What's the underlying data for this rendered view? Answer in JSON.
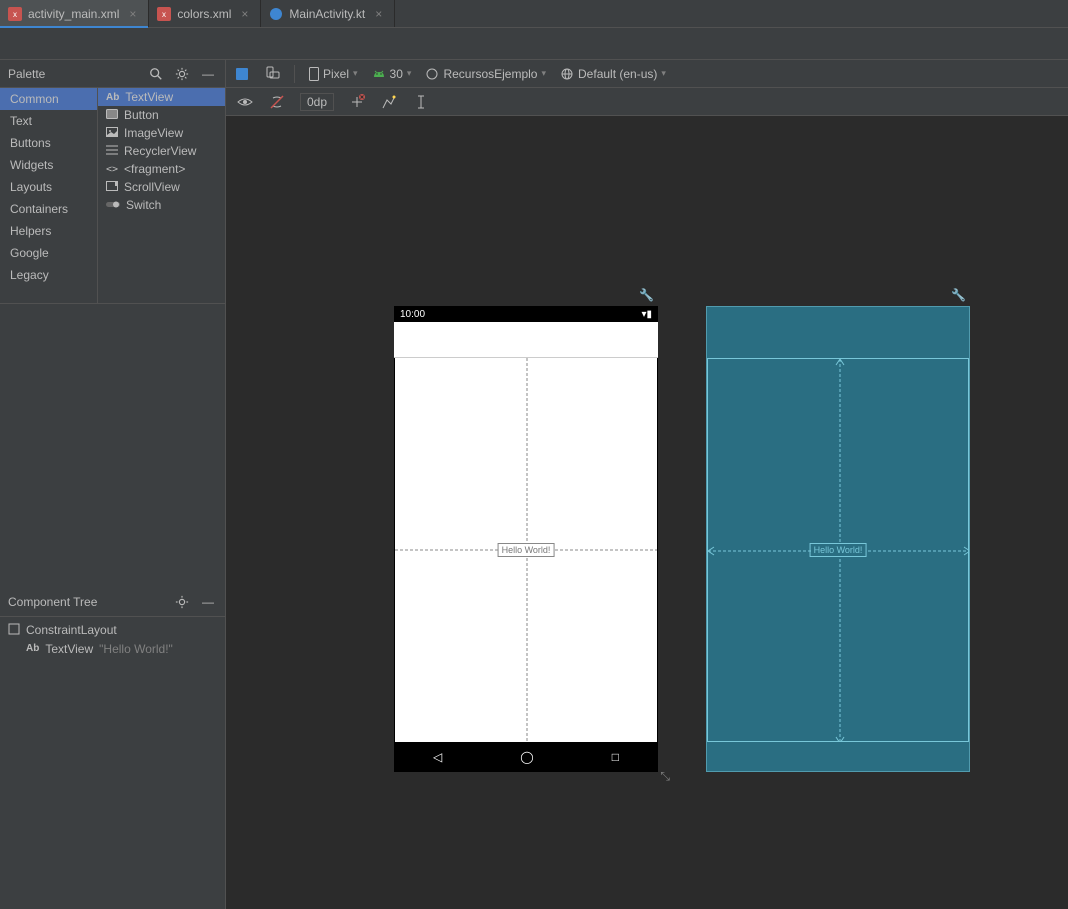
{
  "tabs": [
    {
      "label": "activity_main.xml",
      "icon": "xml",
      "active": true
    },
    {
      "label": "colors.xml",
      "icon": "xml",
      "active": false
    },
    {
      "label": "MainActivity.kt",
      "icon": "kotlin",
      "active": false
    }
  ],
  "palette": {
    "title": "Palette",
    "categories": [
      "Common",
      "Text",
      "Buttons",
      "Widgets",
      "Layouts",
      "Containers",
      "Helpers",
      "Google",
      "Legacy"
    ],
    "selected_category": "Common",
    "items": [
      {
        "label": "TextView",
        "icon": "Ab"
      },
      {
        "label": "Button",
        "icon": "button"
      },
      {
        "label": "ImageView",
        "icon": "image"
      },
      {
        "label": "RecyclerView",
        "icon": "list"
      },
      {
        "label": "<fragment>",
        "icon": "frag"
      },
      {
        "label": "ScrollView",
        "icon": "scroll"
      },
      {
        "label": "Switch",
        "icon": "switch"
      }
    ],
    "selected_item": "TextView"
  },
  "component_tree": {
    "title": "Component Tree",
    "nodes": [
      {
        "label": "ConstraintLayout",
        "icon": "layout"
      },
      {
        "label": "TextView",
        "value": "\"Hello World!\"",
        "icon": "Ab",
        "indent": 1
      }
    ]
  },
  "design_toolbar": {
    "device": "Pixel",
    "api": "30",
    "app_theme": "RecursosEjemplo",
    "locale": "Default (en-us)"
  },
  "sub_toolbar": {
    "margin": "0dp"
  },
  "device_preview": {
    "status_time": "10:00",
    "textview_text": "Hello World!"
  }
}
